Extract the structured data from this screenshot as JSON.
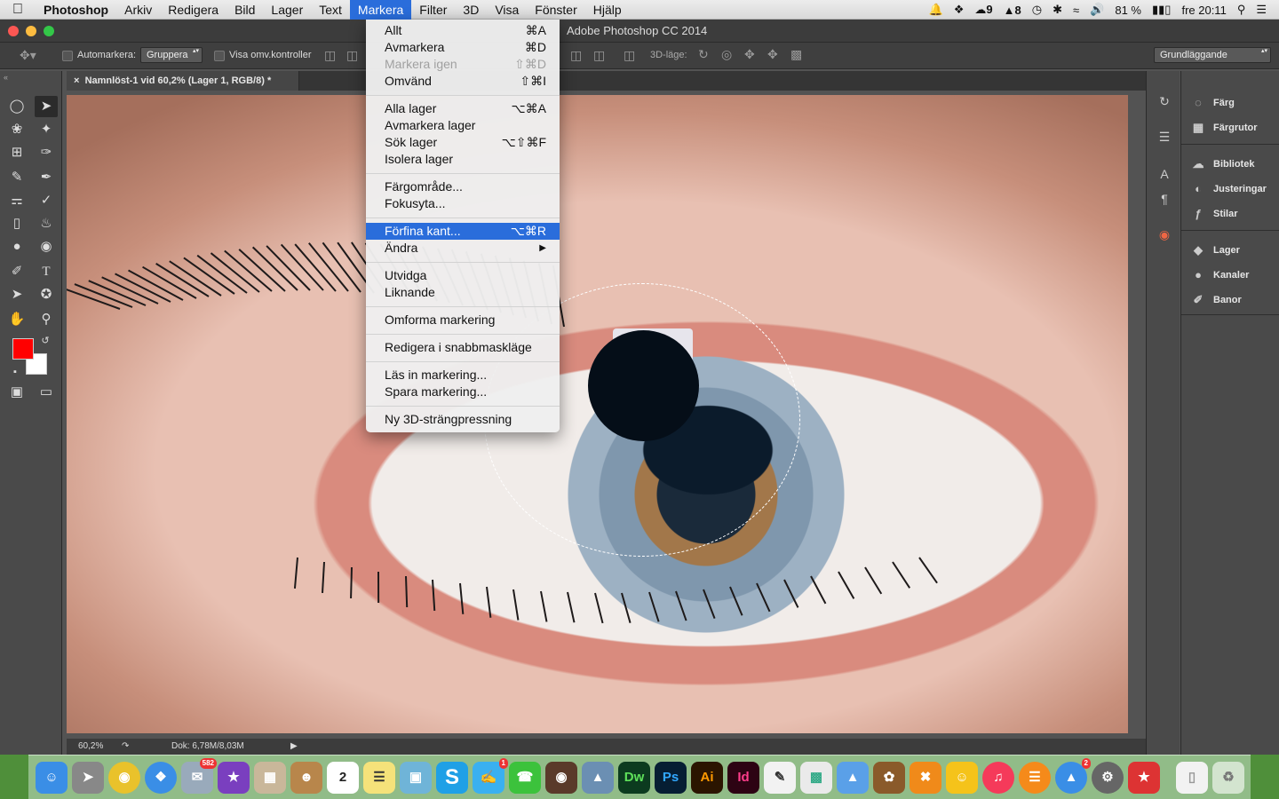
{
  "menubar": {
    "app": "Photoshop",
    "items": [
      "Arkiv",
      "Redigera",
      "Bild",
      "Lager",
      "Text",
      "Markera",
      "Filter",
      "3D",
      "Visa",
      "Fönster",
      "Hjälp"
    ],
    "active": "Markera",
    "status": {
      "notifications_count": "9",
      "adobe_count": "8",
      "battery": "81 %",
      "clock": "fre 20:11"
    }
  },
  "window": {
    "title": "Adobe Photoshop CC 2014"
  },
  "options": {
    "auto_select_label": "Automarkera:",
    "auto_select_value": "Gruppera",
    "show_transform_label": "Visa omv.kontroller",
    "mode_3d_label": "3D-läge:",
    "workspace": "Grundläggande"
  },
  "document": {
    "tab": "Namnlöst-1 vid 60,2% (Lager 1, RGB/8) *",
    "zoom": "60,2%",
    "doc_info": "Dok: 6,78M/8,03M"
  },
  "colors": {
    "foreground": "#ff0000",
    "background": "#ffffff",
    "menu_highlight": "#2a6ddb"
  },
  "menu": {
    "items": [
      {
        "label": "Allt",
        "shortcut": "⌘A",
        "state": "enabled"
      },
      {
        "label": "Avmarkera",
        "shortcut": "⌘D",
        "state": "enabled"
      },
      {
        "label": "Markera igen",
        "shortcut": "⇧⌘D",
        "state": "disabled"
      },
      {
        "label": "Omvänd",
        "shortcut": "⇧⌘I",
        "state": "enabled"
      },
      {
        "label": "Alla lager",
        "shortcut": "⌥⌘A",
        "state": "enabled"
      },
      {
        "label": "Avmarkera lager",
        "shortcut": "",
        "state": "enabled"
      },
      {
        "label": "Sök lager",
        "shortcut": "⌥⇧⌘F",
        "state": "enabled"
      },
      {
        "label": "Isolera lager",
        "shortcut": "",
        "state": "enabled"
      },
      {
        "label": "Färgområde...",
        "shortcut": "",
        "state": "enabled"
      },
      {
        "label": "Fokusyta...",
        "shortcut": "",
        "state": "enabled"
      },
      {
        "label": "Förfina kant...",
        "shortcut": "⌥⌘R",
        "state": "highlighted"
      },
      {
        "label": "Ändra",
        "shortcut": "▶",
        "state": "enabled"
      },
      {
        "label": "Utvidga",
        "shortcut": "",
        "state": "enabled"
      },
      {
        "label": "Liknande",
        "shortcut": "",
        "state": "enabled"
      },
      {
        "label": "Omforma markering",
        "shortcut": "",
        "state": "enabled"
      },
      {
        "label": "Redigera i snabbmaskläge",
        "shortcut": "",
        "state": "enabled"
      },
      {
        "label": "Läs in markering...",
        "shortcut": "",
        "state": "enabled"
      },
      {
        "label": "Spara markering...",
        "shortcut": "",
        "state": "enabled"
      },
      {
        "label": "Ny 3D-strängpressning",
        "shortcut": "",
        "state": "enabled"
      }
    ]
  },
  "panels": {
    "group1": [
      "Färg",
      "Färgrutor"
    ],
    "group2": [
      "Bibliotek",
      "Justeringar",
      "Stilar"
    ],
    "group3": [
      "Lager",
      "Kanaler",
      "Banor"
    ]
  },
  "dock": {
    "dw": "Dw",
    "ps": "Ps",
    "ai": "Ai",
    "id": "Id",
    "skype": "S",
    "mail_badge": "582",
    "calendar_day": "2",
    "messages_badge": "1",
    "appstore_badge": "2"
  }
}
